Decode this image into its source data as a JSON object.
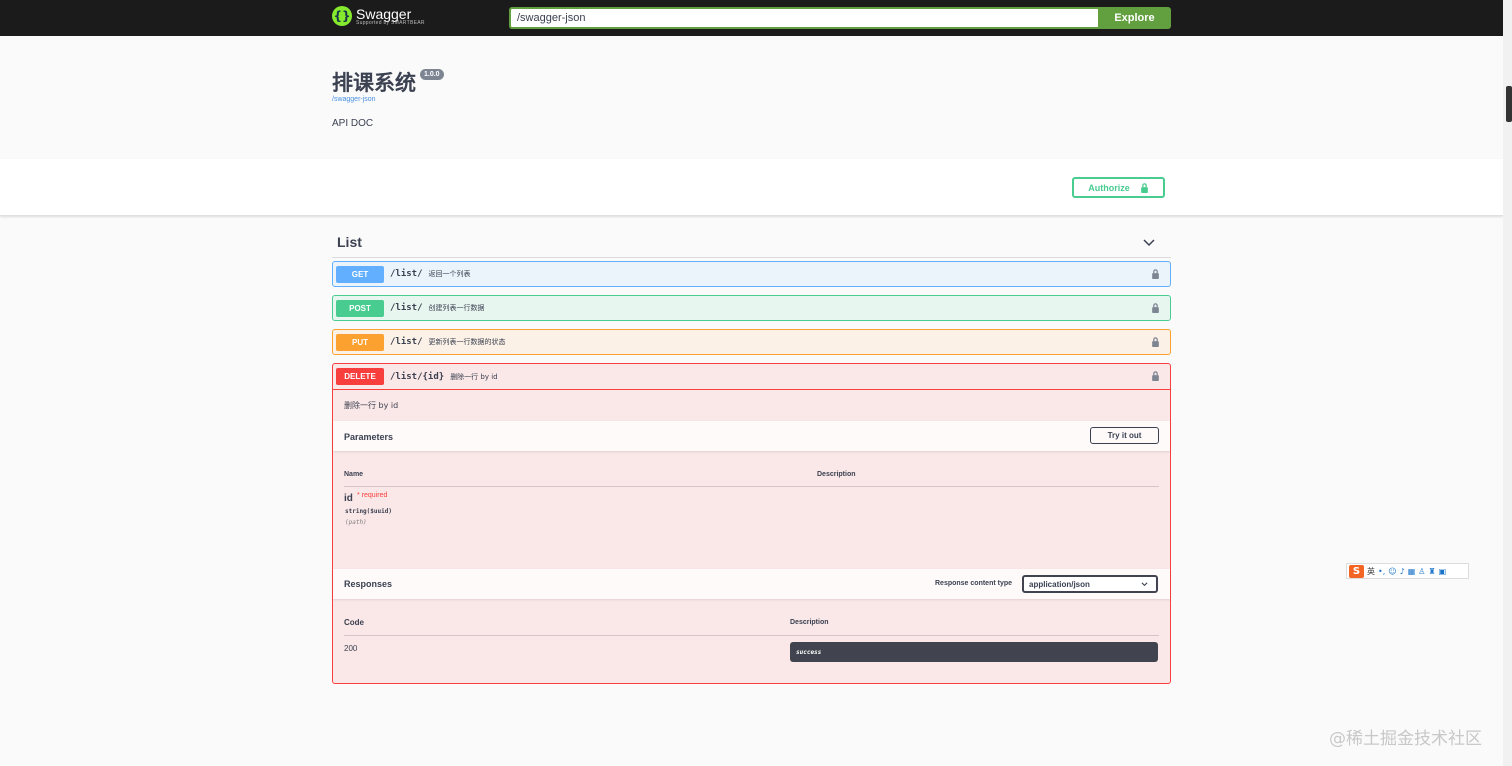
{
  "topbar": {
    "logo_title": "Swagger",
    "logo_sub": "Supported by SMARTBEAR",
    "url_value": "/swagger-json",
    "explore_label": "Explore"
  },
  "info": {
    "title": "排课系统",
    "version": "1.0.0",
    "link": "/swagger-json",
    "description": "API DOC"
  },
  "scheme": {
    "authorize_label": "Authorize"
  },
  "section": {
    "title": "List"
  },
  "operations": [
    {
      "method": "GET",
      "path": "/list/",
      "summary": "返回一个列表"
    },
    {
      "method": "POST",
      "path": "/list/",
      "summary": "创建列表一行数据"
    },
    {
      "method": "PUT",
      "path": "/list/",
      "summary": "更新列表一行数据的状态"
    },
    {
      "method": "DELETE",
      "path": "/list/{id}",
      "summary": "删除一行 by id"
    }
  ],
  "delete_detail": {
    "description": "删除一行 by id",
    "parameters_title": "Parameters",
    "try_label": "Try it out",
    "col_name": "Name",
    "col_description": "Description",
    "param": {
      "name": "id",
      "required": "* required",
      "type": "string($uuid)",
      "in": "(path)"
    },
    "responses_title": "Responses",
    "content_type_label": "Response content type",
    "content_type_value": "application/json",
    "code_header": "Code",
    "desc_header": "Description",
    "response": {
      "code": "200",
      "description": "success"
    }
  },
  "ime": {
    "lang": "英"
  },
  "watermark": "@稀土掘金技术社区",
  "colors": {
    "get": "#61affe",
    "post": "#49cc90",
    "put": "#fca130",
    "delete": "#f93e3e",
    "explore": "#62a03f"
  }
}
